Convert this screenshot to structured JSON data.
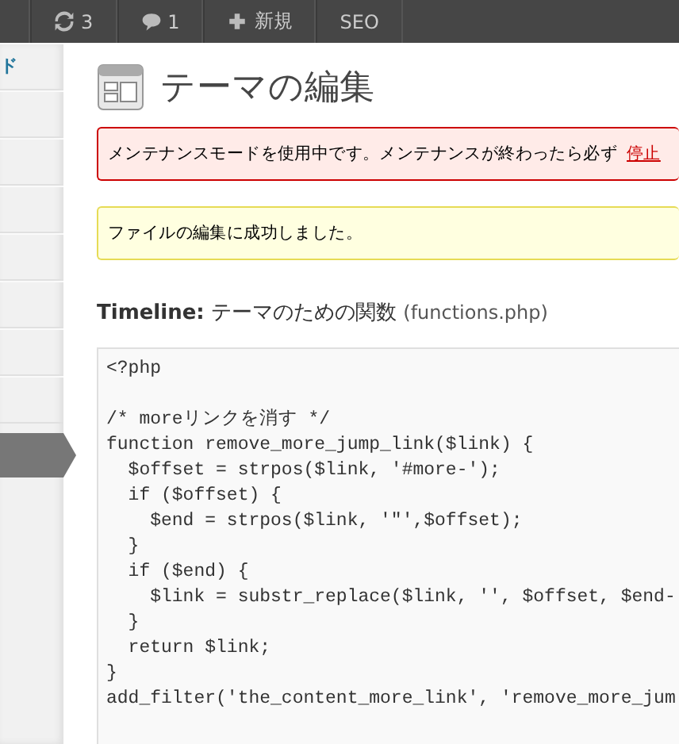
{
  "admin_bar": {
    "items": [
      {
        "kind": "updates",
        "label": "3"
      },
      {
        "kind": "comments",
        "label": "1"
      },
      {
        "kind": "new",
        "label": "新規"
      },
      {
        "kind": "text",
        "label": "SEO"
      }
    ]
  },
  "sidebar": {
    "items": [
      {
        "label": "ド",
        "selected": false
      },
      {
        "selected": false
      },
      {
        "selected": false
      },
      {
        "selected": false
      },
      {
        "selected": false
      },
      {
        "selected": false
      },
      {
        "selected": false
      },
      {
        "selected": false
      },
      {
        "selected": true
      }
    ]
  },
  "page_title": "テーマの編集",
  "notices": [
    {
      "kind": "error",
      "text": "メンテナンスモードを使用中です。メンテナンスが終わったら必ず",
      "link": "停止"
    },
    {
      "kind": "updated",
      "text": "ファイルの編集に成功しました。"
    }
  ],
  "file_heading": {
    "theme": "Timeline:",
    "title": "テーマのための関数",
    "file": "(functions.php)"
  },
  "code": "<?php\n\n/* moreリンクを消す */\nfunction remove_more_jump_link($link) {\n  $offset = strpos($link, '#more-');\n  if ($offset) {\n    $end = strpos($link, '\"',$offset);\n  }\n  if ($end) {\n    $link = substr_replace($link, '', $offset, $end-\n  }\n  return $link;\n}\nadd_filter('the_content_more_link', 'remove_more_jum"
}
